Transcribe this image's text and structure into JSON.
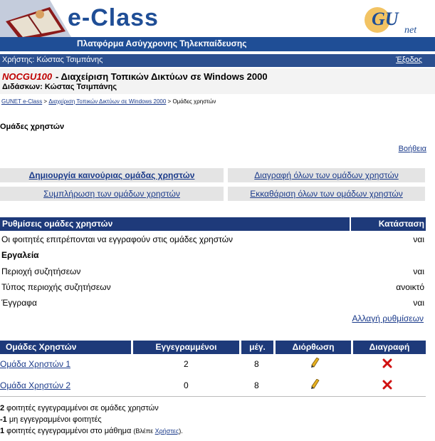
{
  "banner": {
    "logo_text": "e-Class",
    "subtitle": "Πλατφόρμα Ασύγχρονης Τηλεκπαίδευσης",
    "gunet_logo": "GU net",
    "colors": {
      "brand_blue": "#1f4e96",
      "header_blue": "#1e3a7a"
    }
  },
  "userbar": {
    "user": "Χρήστης: Κώστας Τσιμπάνης",
    "logout": "Έξοδος"
  },
  "course": {
    "code": "NOCGU100",
    "name": " - Διαχείριση Τοπικών Δικτύων σε Windows 2000",
    "teacher": "Διδάσκων: Κώστας Τσιμπάνης"
  },
  "breadcrumb": {
    "home": "GUNET e-Class",
    "sep": " > ",
    "course": "Διαχείριση Τοπικών Δικτύων σε Windows 2000",
    "current": "Ομάδες χρηστών"
  },
  "page": {
    "title": "Ομάδες χρηστών",
    "help": "Βοήθεια"
  },
  "actions": {
    "create": "Δημιουργία καινούριας ομάδας χρηστών",
    "delete_all": "Διαγραφή όλων των ομάδων χρηστών",
    "fill": "Συμπλήρωση των ομάδων χρηστών",
    "clean": "Εκκαθάριση όλων των ομάδων χρηστών"
  },
  "settings": {
    "header_left": "Ρυθμίσεις ομάδες χρηστών",
    "header_right": "Κατάσταση",
    "rows": [
      {
        "label": "Οι φοιτητές επιτρέπονται να εγγραφούν στις ομάδες χρηστών",
        "value": "ναι"
      },
      {
        "label": "Εργαλεία",
        "value": ""
      },
      {
        "label": "Περιοχή συζητήσεων",
        "value": "ναι"
      },
      {
        "label": "Τύπος περιοχής συζητήσεων",
        "value": "ανοικτό"
      },
      {
        "label": "Έγγραφα",
        "value": "ναι"
      }
    ],
    "change": "Αλλαγή ρυθμίσεων"
  },
  "groups": {
    "headers": [
      "Ομάδες Χρηστών",
      "Εγγεγραμμένοι",
      "μέγ.",
      "Διόρθωση",
      "Διαγραφή"
    ],
    "rows": [
      {
        "name": "Ομάδα Χρηστών 1",
        "registered": "2",
        "max": "8",
        "edit_icon": "pencil-icon",
        "delete_icon": "red-x-icon"
      },
      {
        "name": "Ομάδα Χρηστών 2",
        "registered": "0",
        "max": "8",
        "edit_icon": "pencil-icon",
        "delete_icon": "red-x-icon"
      }
    ]
  },
  "stats": {
    "line1_num": "2",
    "line1_text": " φοιτητές εγγεγραμμένοι σε ομάδες χρηστών",
    "line2_num": "-1",
    "line2_text": " μη εγγεγραμμένοι φοιτητές",
    "line3_num": "1",
    "line3_text": " φοιτητές εγγεγραμμένοι στο μάθημα ",
    "line3_see": "(Βλέπε ",
    "line3_link": "Χρήστες",
    "line3_end": ")."
  }
}
